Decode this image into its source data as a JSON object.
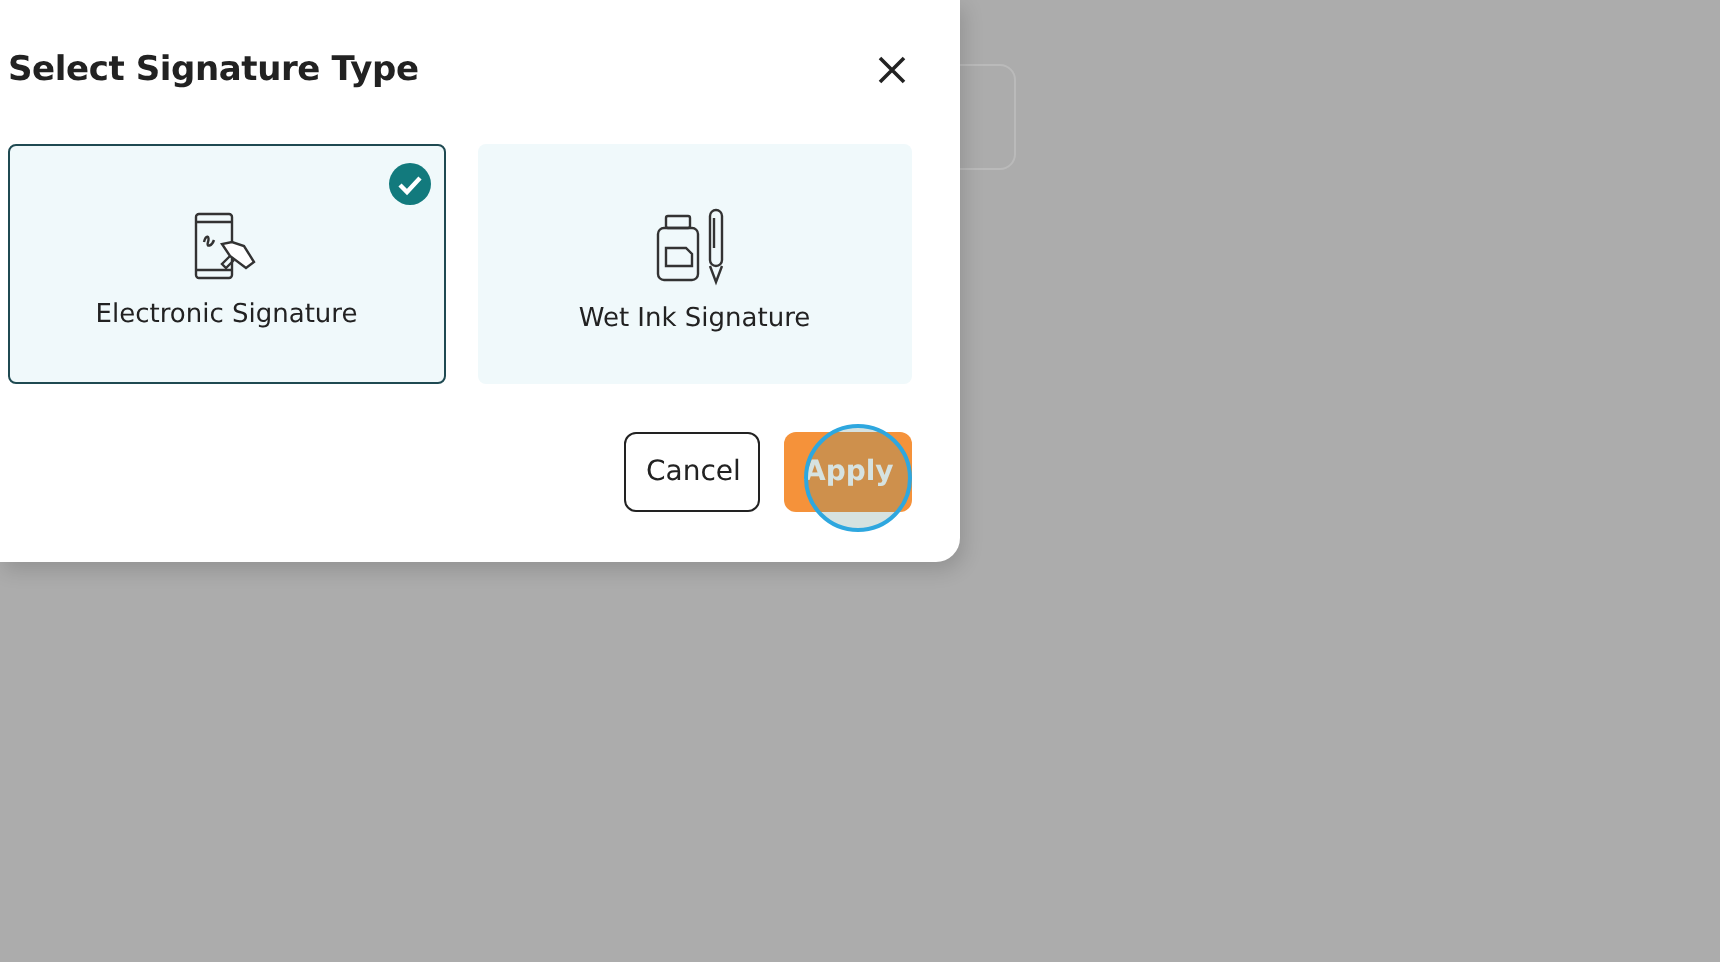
{
  "dialog": {
    "title": "Select Signature Type",
    "options": [
      {
        "kind": "electronic",
        "label": "Electronic Signature",
        "selected": true
      },
      {
        "kind": "wet_ink",
        "label": "Wet Ink Signature",
        "selected": false
      }
    ],
    "buttons": [
      {
        "kind": "secondary",
        "label": "Cancel"
      },
      {
        "kind": "primary",
        "label": "Apply"
      }
    ]
  }
}
